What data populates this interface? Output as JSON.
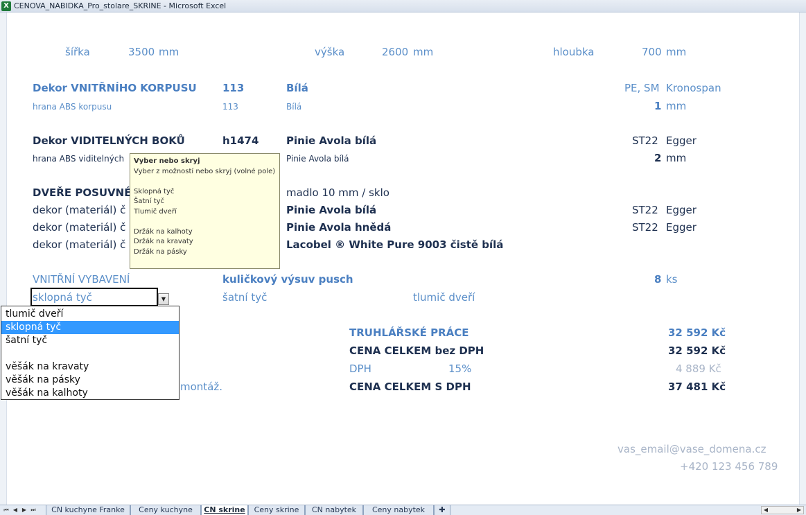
{
  "window": {
    "title": "CENOVA_NABIDKA_Pro_stolare_SKRINE - Microsoft Excel",
    "app_icon": "excel-icon"
  },
  "dims": {
    "width_label": "šířka",
    "width_value": "3500",
    "width_unit": "mm",
    "height_label": "výška",
    "height_value": "2600",
    "height_unit": "mm",
    "depth_label": "hloubka",
    "depth_value": "700",
    "depth_unit": "mm"
  },
  "inner": {
    "title": "Dekor VNITŘNÍHO KORPUSU",
    "code": "113",
    "name": "Bílá",
    "material": "PE, SM",
    "vendor": "Kronospan",
    "edge_label": "hrana ABS korpusu",
    "edge_code": "113",
    "edge_name": "Bílá",
    "edge_thickness": "1",
    "edge_unit": "mm"
  },
  "visible": {
    "title": "Dekor VIDITELNÝCH BOKŮ",
    "code": "h1474",
    "name": "Pinie Avola bílá",
    "material": "ST22",
    "vendor": "Egger",
    "edge_label": "hrana ABS viditelných",
    "edge_name": "Pinie Avola bílá",
    "edge_thickness": "2",
    "edge_unit": "mm"
  },
  "doors": {
    "title": "DVEŘE POSUVNÉ",
    "handle": "madlo 10 mm / sklo",
    "rows": [
      {
        "label": "dekor (materiál) č",
        "name": "Pinie Avola bílá",
        "material": "ST22",
        "vendor": "Egger"
      },
      {
        "label": "dekor (materiál) č",
        "name": "Pinie Avola hnědá",
        "material": "ST22",
        "vendor": "Egger"
      },
      {
        "label": "dekor (materiál) č",
        "name": "Lacobel ® White Pure 9003 čistě bílá",
        "material": "",
        "vendor": ""
      }
    ]
  },
  "equipment": {
    "title": "VNITŘNÍ VYBAVENÍ",
    "drawer": "kuličkový výsuv pusch",
    "count": "8",
    "count_unit": "ks",
    "selected_value": "sklopná tyč",
    "item2": "šatní tyč",
    "item3": "tlumič dveří"
  },
  "tooltip": {
    "title": "Vyber nebo skryj",
    "subtitle": "Vyber z možností nebo skryj (volné pole)",
    "options": [
      "Sklopná tyč",
      "Šatní tyč",
      "Tlumič dveří",
      "Držák na kalhoty",
      "Držák na kravaty",
      "Držák na pásky"
    ]
  },
  "dropdown": {
    "options": [
      "tlumič dveří",
      "sklopná tyč",
      "šatní tyč",
      "",
      "věšák na kravaty",
      "věšák na pásky",
      "věšák na kalhoty"
    ],
    "selected_index": 1
  },
  "totals": {
    "work_label": "TRUHLÁŘSKÉ PRÁCE",
    "work_value": "32 592 Kč",
    "net_label": "CENA CELKEM bez DPH",
    "net_value": "32 592 Kč",
    "vat_label": "DPH",
    "vat_rate": "15%",
    "vat_value": "4 889 Kč",
    "gross_label": "CENA CELKEM S DPH",
    "gross_value": "37 481 Kč",
    "note_tail": "montáž."
  },
  "contact": {
    "email": "vas_email@vase_domena.cz",
    "phone": "+420 123 456 789"
  },
  "tabs": [
    {
      "label": "CN kuchyne  Franke",
      "active": false
    },
    {
      "label": "Ceny kuchyne",
      "active": false
    },
    {
      "label": "CN skrine",
      "active": true
    },
    {
      "label": "Ceny skrine",
      "active": false
    },
    {
      "label": "CN nabytek",
      "active": false
    },
    {
      "label": "Ceny  nabytek",
      "active": false
    }
  ],
  "colors": {
    "label_blue": "#5b8fc9",
    "dark_navy": "#1e3050",
    "selection": "#3399ff",
    "tooltip_bg": "#ffffe1"
  }
}
